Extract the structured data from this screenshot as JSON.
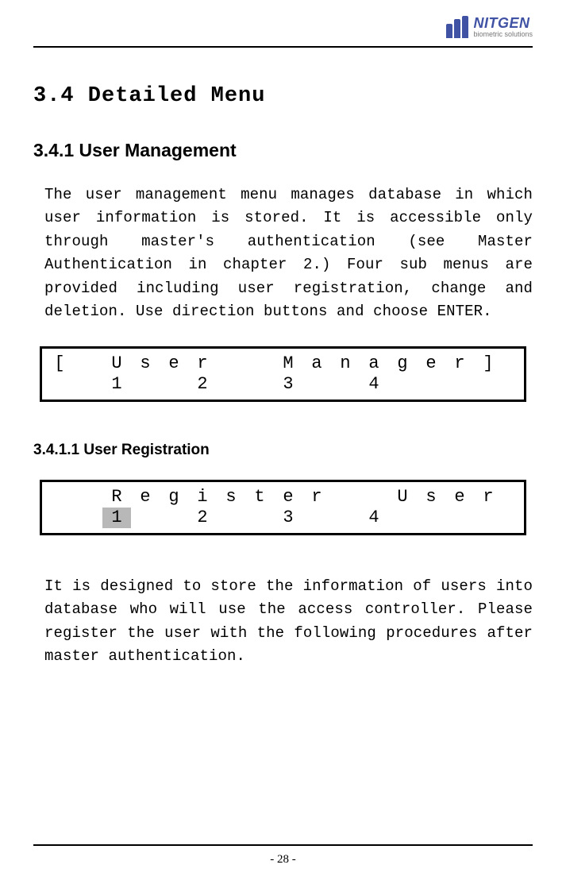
{
  "logo": {
    "title": "NITGEN",
    "subtitle": "biometric solutions"
  },
  "section_heading": "3.4 Detailed Menu",
  "sub_heading_1": "3.4.1 User Management",
  "paragraph_1": "The user management menu manages database in which user information is stored. It is accessible only through master's authentication (see Master Authentication in chapter 2.) Four sub menus are provided including user registration, change and deletion. Use direction buttons and choose ENTER.",
  "lcd1": {
    "row1": [
      "[",
      "",
      "U",
      "s",
      "e",
      "r",
      "",
      "",
      "M",
      "a",
      "n",
      "a",
      "g",
      "e",
      "r",
      "]"
    ],
    "row2": [
      "",
      "",
      "1",
      "",
      "",
      "2",
      "",
      "",
      "3",
      "",
      "",
      "4",
      "",
      "",
      "",
      ""
    ]
  },
  "sub_heading_2": "3.4.1.1 User Registration",
  "lcd2": {
    "row1": [
      "",
      "",
      "R",
      "e",
      "g",
      "i",
      "s",
      "t",
      "e",
      "r",
      "",
      "",
      "U",
      "s",
      "e",
      "r"
    ],
    "row2": [
      "",
      "",
      "1",
      "",
      "",
      "2",
      "",
      "",
      "3",
      "",
      "",
      "4",
      "",
      "",
      "",
      ""
    ],
    "highlight_index": 2
  },
  "paragraph_2": "It is designed to store the information of users into database who will use the access controller. Please register the user with the following procedures after master authentication.",
  "page_number": "- 28 -"
}
